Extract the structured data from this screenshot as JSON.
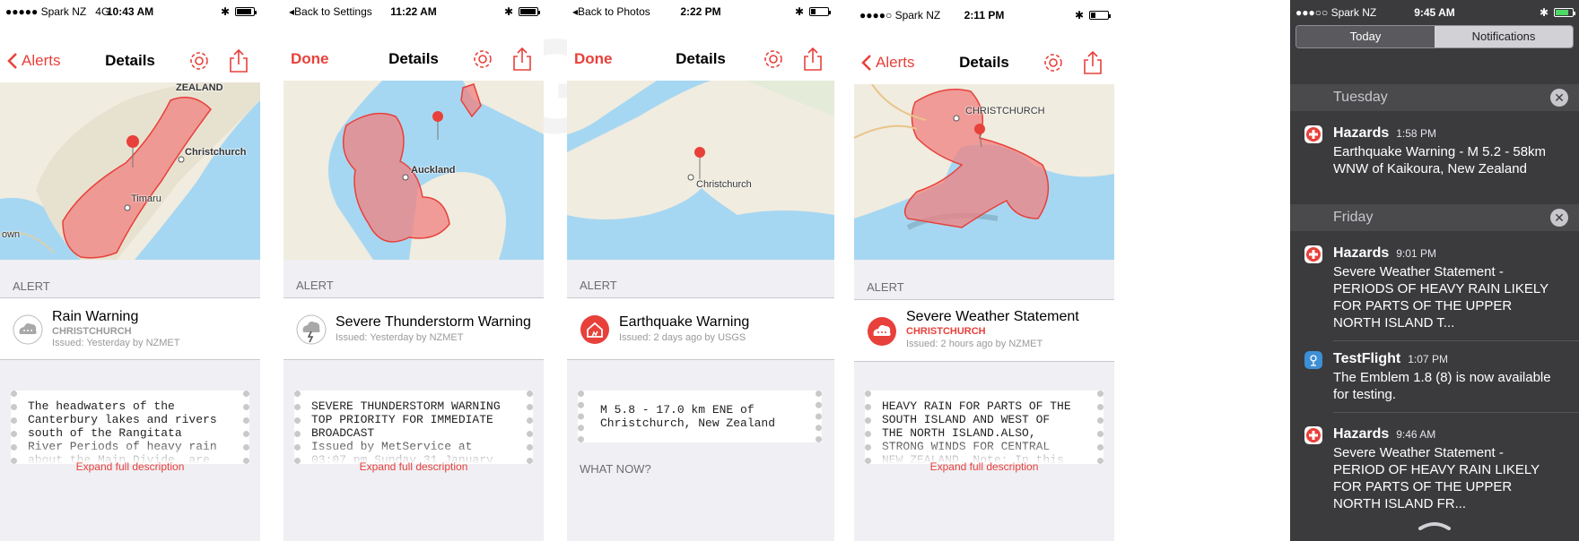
{
  "colors": {
    "accent": "#e8403a",
    "hazard_fill": "#f08080",
    "map_water": "#a6d7f2",
    "map_land": "#f0ecdf"
  },
  "screens": [
    {
      "status": {
        "carrier": "●●●●● Spark NZ",
        "network": "4G",
        "time": "10:43 AM"
      },
      "nav": {
        "back_label": "Alerts",
        "title": "Details"
      },
      "map_labels": [
        "ZEALAND",
        "Christchurch",
        "Timaru",
        "own"
      ],
      "section_label": "ALERT",
      "alert": {
        "title": "Rain Warning",
        "region": "CHRISTCHURCH",
        "issued": "Issued: Yesterday by NZMET",
        "icon": "rain-cloud-icon"
      },
      "description": "The headwaters of the\nCanterbury lakes and rivers\nsouth of the Rangitata\nRiver Periods of heavy rain\nabout the Main Divide, are",
      "expand_label": "Expand full description"
    },
    {
      "status": {
        "carrier": "◂Back to Settings",
        "time": "11:22 AM"
      },
      "nav": {
        "back_label": "Done",
        "title": "Details"
      },
      "map_labels": [
        "Auckland"
      ],
      "section_label": "ALERT",
      "alert": {
        "title": "Severe Thunderstorm Warning",
        "region": "",
        "issued": "Issued: Yesterday by NZMET",
        "icon": "thunderstorm-icon"
      },
      "description": "SEVERE THUNDERSTORM WARNING\nTOP PRIORITY FOR IMMEDIATE\nBROADCAST\nIssued by MetService at\n03:07 pm Sunday 31 January",
      "expand_label": "Expand full description"
    },
    {
      "status": {
        "carrier": "◂Back to Photos",
        "time": "2:22 PM"
      },
      "nav": {
        "back_label": "Done",
        "title": "Details"
      },
      "map_labels": [
        "Christchurch"
      ],
      "section_label": "ALERT",
      "alert": {
        "title": "Earthquake Warning",
        "region": "",
        "issued": "Issued: 2 days ago by USGS",
        "icon": "earthquake-house-icon"
      },
      "description": "M 5.8 - 17.0 km ENE of\nChristchurch, New Zealand",
      "next_section_label": "WHAT NOW?"
    },
    {
      "status": {
        "carrier": "●●●●○ Spark NZ",
        "time": "2:11 PM"
      },
      "nav": {
        "back_label": "Alerts",
        "title": "Details"
      },
      "map_labels": [
        "CHRISTCHURCH"
      ],
      "section_label": "ALERT",
      "alert": {
        "title": "Severe Weather Statement",
        "region": "CHRISTCHURCH",
        "issued": "Issued: 2 hours ago by NZMET",
        "icon": "severe-weather-cloud-icon"
      },
      "description": "HEAVY RAIN FOR PARTS OF THE\nSOUTH ISLAND AND WEST OF\nTHE NORTH ISLAND.ALSO,\nSTRONG WINDS FOR CENTRAL\nNEW ZEALAND. Note: In this",
      "expand_label": "Expand full description"
    }
  ],
  "notification_center": {
    "status": {
      "carrier": "●●●○○ Spark NZ",
      "time": "9:45 AM"
    },
    "tabs": [
      "Today",
      "Notifications"
    ],
    "days": [
      {
        "name": "Tuesday",
        "clear": "✕"
      },
      {
        "name": "Friday",
        "clear": "✕"
      }
    ],
    "notifications": [
      {
        "app": "Hazards",
        "time": "1:58 PM",
        "body": "Earthquake Warning - M 5.2 - 58km WNW of Kaikoura, New Zealand",
        "icon": "hazards-app-icon"
      },
      {
        "app": "Hazards",
        "time": "9:01 PM",
        "body": "Severe Weather Statement - PERIODS OF HEAVY RAIN LIKELY FOR PARTS OF THE UPPER NORTH ISLAND T...",
        "icon": "hazards-app-icon"
      },
      {
        "app": "TestFlight",
        "time": "1:07 PM",
        "body": "The Emblem 1.8 (8) is now available for testing.",
        "icon": "testflight-app-icon"
      },
      {
        "app": "Hazards",
        "time": "9:46 AM",
        "body": "Severe Weather Statement - PERIOD OF HEAVY RAIN LIKELY FOR PARTS OF THE UPPER NORTH ISLAND FR...",
        "icon": "hazards-app-icon"
      }
    ]
  }
}
